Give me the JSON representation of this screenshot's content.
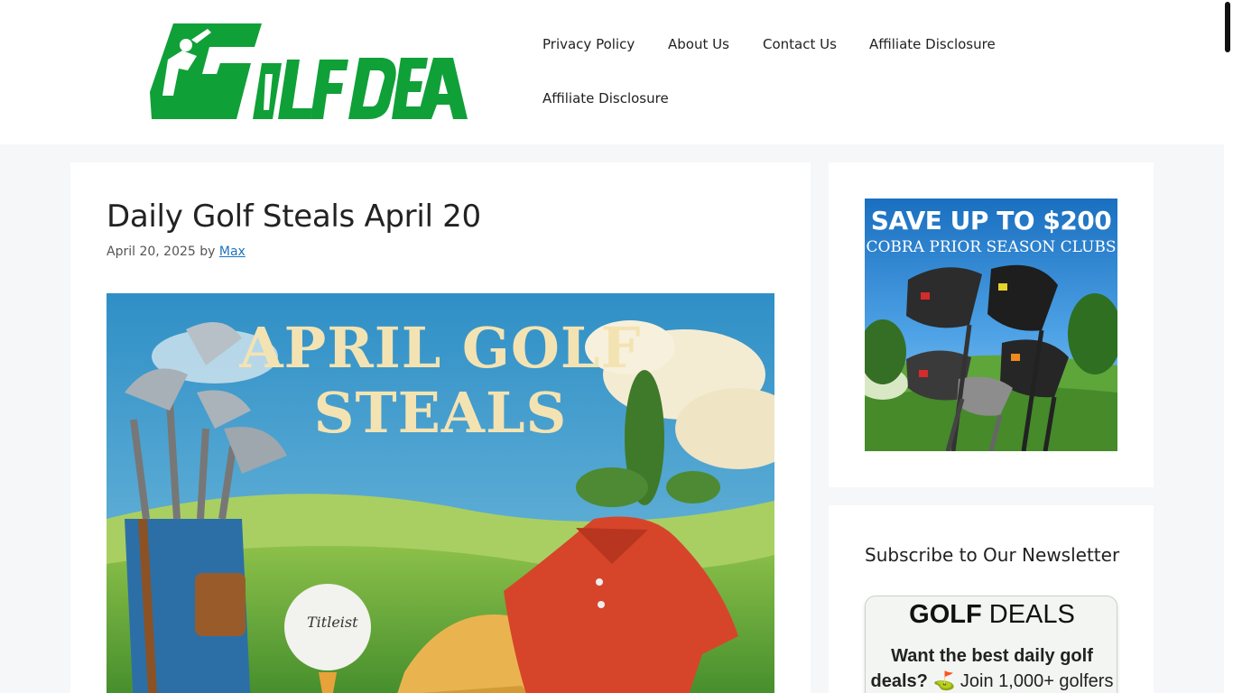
{
  "brand": {
    "logo_text": "GOLF DEALS",
    "logo_color": "#10a038"
  },
  "nav": {
    "items": [
      {
        "label": "Privacy Policy"
      },
      {
        "label": "About Us"
      },
      {
        "label": "Contact Us"
      },
      {
        "label": "Affiliate Disclosure"
      },
      {
        "label": "Affiliate Disclosure"
      }
    ]
  },
  "article": {
    "title": "Daily Golf Steals April 20",
    "date": "April 20, 2025",
    "by": "by",
    "author": "Max",
    "image_text_line1": "APRIL GOLF",
    "image_text_line2": "STEALS",
    "ball_brand": "Titleist"
  },
  "sidebar": {
    "ad": {
      "headline": "SAVE UP TO $200",
      "subline": "COBRA PRIOR SEASON CLUBS"
    },
    "newsletter": {
      "title": "Subscribe to Our Newsletter",
      "brand_bold": "GOLF",
      "brand_rest": " DEALS",
      "text_bold": "Want the best daily golf deals?",
      "emoji": "⛳",
      "text_rest": " Join 1,000+ golfers"
    }
  },
  "colors": {
    "link": "#1e73be",
    "page_bg": "#f6f7f9",
    "accent_green": "#10a038"
  }
}
